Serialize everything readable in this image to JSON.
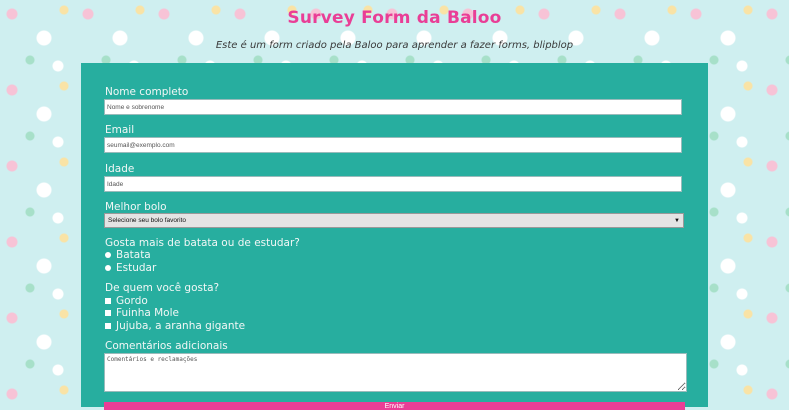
{
  "header": {
    "title": "Survey Form da Baloo",
    "subtitle": "Este é um form criado pela Baloo para aprender a fazer forms, blipblop"
  },
  "form": {
    "name": {
      "label": "Nome completo",
      "placeholder": "Nome e sobrenome"
    },
    "email": {
      "label": "Email",
      "placeholder": "seumail@exemplo.com"
    },
    "age": {
      "label": "Idade",
      "placeholder": "Idade"
    },
    "cake": {
      "label": "Melhor bolo",
      "selected": "Selecione seu bolo favorito"
    },
    "question1": {
      "label": "Gosta mais de batata ou de estudar?",
      "options": [
        "Batata",
        "Estudar"
      ]
    },
    "question2": {
      "label": "De quem você gosta?",
      "options": [
        "Gordo",
        "Fuinha Mole",
        "Jujuba, a aranha gigante"
      ]
    },
    "comments": {
      "label": "Comentários adicionais",
      "placeholder": "Comentários e reclamações"
    },
    "submit_label": "Enviar"
  },
  "colors": {
    "accent": "#e93e96",
    "card": "#27ae9f",
    "background": "#cfeff0"
  },
  "icons": [
    "select-arrow-icon"
  ]
}
